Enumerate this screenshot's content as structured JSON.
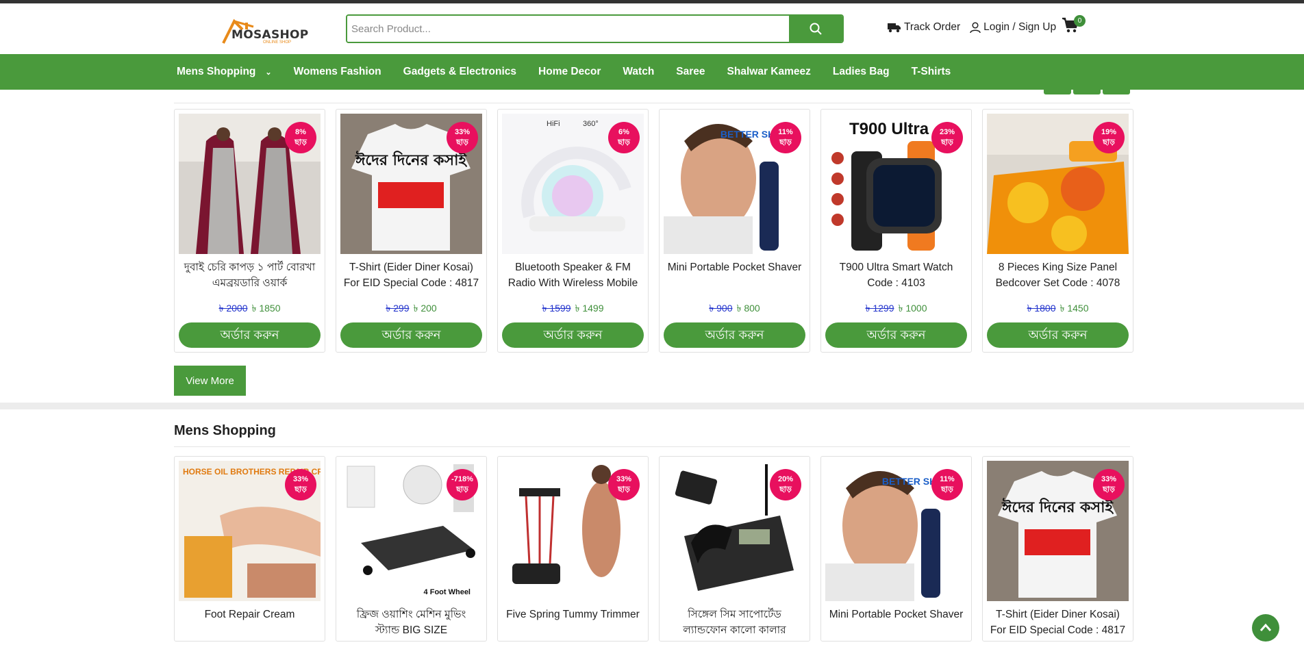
{
  "brand": {
    "name": "MOSASHOP",
    "tagline": "ONLINE SHOP"
  },
  "search": {
    "placeholder": "Search Product..."
  },
  "header": {
    "track_order": "Track Order",
    "login": "Login / Sign Up",
    "cart_count": "0"
  },
  "nav": [
    {
      "label": "Mens Shopping",
      "has_dropdown": true
    },
    {
      "label": "Womens Fashion"
    },
    {
      "label": "Gadgets & Electronics"
    },
    {
      "label": "Home Decor"
    },
    {
      "label": "Watch"
    },
    {
      "label": "Saree"
    },
    {
      "label": "Shalwar Kameez"
    },
    {
      "label": "Ladies Bag"
    },
    {
      "label": "T-Shirts"
    }
  ],
  "colors": {
    "accent": "#4a9a3c",
    "discount": "#e8105e",
    "old_price": "#2233cc"
  },
  "featured": {
    "products": [
      {
        "title": "দুবাই চেরি কাপড় ১ পার্ট বোরখা এমব্রয়ডারি ওয়ার্ক",
        "discount": "8%",
        "discount_word": "ছাড়",
        "old_price": "৳ 2000",
        "new_price": "৳ 1850",
        "button": "অর্ডার করুন",
        "image": "burqa"
      },
      {
        "title": "T-Shirt (Eider Diner Kosai) For EID Special Code : 4817",
        "discount": "33%",
        "discount_word": "ছাড়",
        "old_price": "৳ 299",
        "new_price": "৳ 200",
        "button": "অর্ডার করুন",
        "image": "tshirt"
      },
      {
        "title": "Bluetooth Speaker & FM Radio With Wireless Mobile",
        "discount": "6%",
        "discount_word": "ছাড়",
        "old_price": "৳ 1599",
        "new_price": "৳ 1499",
        "button": "অর্ডার করুন",
        "image": "speaker"
      },
      {
        "title": "Mini Portable Pocket Shaver",
        "discount": "11%",
        "discount_word": "ছাড়",
        "old_price": "৳ 900",
        "new_price": "৳ 800",
        "button": "অর্ডার করুন",
        "image": "shaver"
      },
      {
        "title": "T900 Ultra Smart Watch Code : 4103",
        "discount": "23%",
        "discount_word": "ছাড়",
        "old_price": "৳ 1299",
        "new_price": "৳ 1000",
        "button": "অর্ডার করুন",
        "image": "watch"
      },
      {
        "title": "8 Pieces King Size Panel Bedcover Set Code : 4078",
        "discount": "19%",
        "discount_word": "ছাড়",
        "old_price": "৳ 1800",
        "new_price": "৳ 1450",
        "button": "অর্ডার করুন",
        "image": "bedcover"
      }
    ],
    "view_more": "View More"
  },
  "mens_section": {
    "title": "Mens Shopping",
    "products": [
      {
        "title": "Foot Repair Cream",
        "discount": "33%",
        "discount_word": "ছাড়",
        "image": "cream",
        "image_text": "HORSE OIL BROTHERS REPAIR CREAM"
      },
      {
        "title": "ফ্রিজ ওয়াশিং মেশিন মুভিং স্ট্যান্ড BIG SIZE",
        "discount": "-718%",
        "discount_word": "ছাড়",
        "image": "stand",
        "image_text": "4 Foot Wheel"
      },
      {
        "title": "Five Spring Tummy Trimmer",
        "discount": "33%",
        "discount_word": "ছাড়",
        "image": "trimmer"
      },
      {
        "title": "সিঙ্গেল সিম সাপোর্টেড ল্যান্ডফোন কালো কালার",
        "discount": "20%",
        "discount_word": "ছাড়",
        "image": "phone"
      },
      {
        "title": "Mini Portable Pocket Shaver",
        "discount": "11%",
        "discount_word": "ছাড়",
        "image": "shaver"
      },
      {
        "title": "T-Shirt (Eider Diner Kosai) For EID Special Code : 4817",
        "discount": "33%",
        "discount_word": "ছাড়",
        "image": "tshirt"
      }
    ]
  },
  "image_texts": {
    "speaker_brand": "HiFi",
    "speaker_360": "360°",
    "shaver_text": "BETTER SHAVE",
    "watch_text": "T900 Ultra",
    "tshirt_text": "ঈদের দিনের কসাই"
  }
}
